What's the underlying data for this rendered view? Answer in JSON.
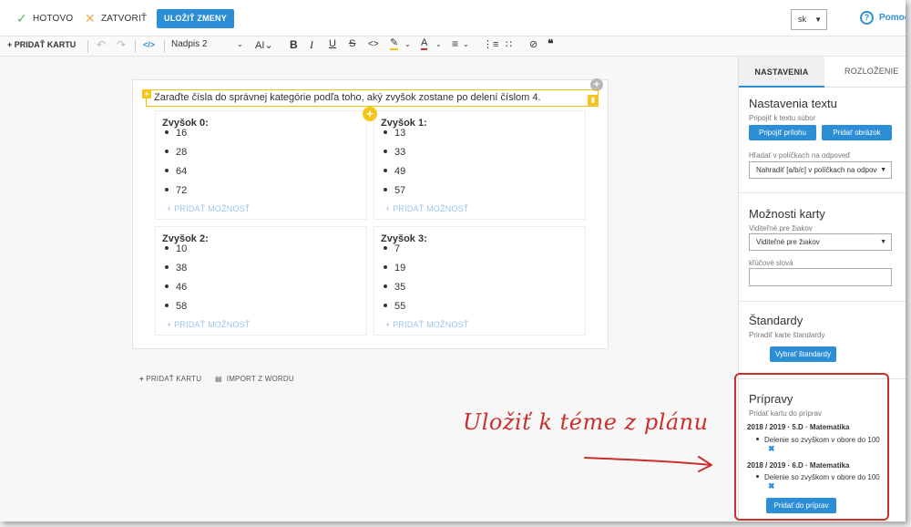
{
  "topbar": {
    "done_label": "HOTOVO",
    "close_label": "ZATVORIŤ",
    "save_label": "ULOŽIŤ ZMENY",
    "language": "sk",
    "help_label": "Pomoc",
    "done_icon": "checkmark-icon",
    "close_icon": "x-icon"
  },
  "toolbar": {
    "add_card_label": "PRIDAŤ KARTU",
    "heading_style": "Nadpis 2",
    "font_size_label": "AI"
  },
  "question": {
    "text": "Zaraďte čísla do správnej kategórie podľa toho, aký zvyšok zostane po delení číslom 4."
  },
  "buckets": [
    {
      "title": "Zvyšok 0:",
      "items": [
        "16",
        "28",
        "64",
        "72"
      ],
      "add_label": "PRIDAŤ MOŽNOSŤ"
    },
    {
      "title": "Zvyšok 1:",
      "items": [
        "13",
        "33",
        "49",
        "57"
      ],
      "add_label": "PRIDAŤ MOŽNOSŤ"
    },
    {
      "title": "Zvyšok 2:",
      "items": [
        "10",
        "38",
        "46",
        "58"
      ],
      "add_label": "PRIDAŤ MOŽNOSŤ"
    },
    {
      "title": "Zvyšok 3:",
      "items": [
        "7",
        "19",
        "35",
        "55"
      ],
      "add_label": "PRIDAŤ MOŽNOSŤ"
    }
  ],
  "below_card": {
    "add_card_label": "PRIDAŤ KARTU",
    "import_label": "IMPORT Z WORDU"
  },
  "panel": {
    "tabs": [
      "NASTAVENIA",
      "ROZLOŽENIE"
    ],
    "text_settings": {
      "title": "Nastavenia textu",
      "attach_label": "Pripojiť k textu súbor",
      "attach_btn": "Pripojiť prílohu",
      "image_btn": "Pridať obrázok",
      "search_label": "Hľadať v políčkach na odpoveď",
      "search_value": "Nahradiť [a/b/c] v políčkach na odpoveď"
    },
    "card_options": {
      "title": "Možnosti karty",
      "visible_label": "Viditeľné pre žiakov",
      "visible_value": "Viditeľné pre žiakov",
      "keywords_label": "kľúčové slová"
    },
    "standards": {
      "title": "Štandardy",
      "assign_label": "Priradiť karte štandardy",
      "select_btn": "Vybrať štandardy"
    },
    "preparations": {
      "title": "Prípravy",
      "add_label": "Pridať kartu do príprav",
      "plans": [
        {
          "title": "2018 / 2019 · 5.D · Matematika",
          "item": "Delenie so zvyškom v obore do 100"
        },
        {
          "title": "2018 / 2019 · 6.D · Matematika",
          "item": "Delenie so zvyškom v obore do 100"
        }
      ],
      "add_btn": "Pridať do príprav"
    }
  },
  "annotation": {
    "text": "Uložiť k téme z plánu",
    "color": "#c9302c"
  },
  "colors": {
    "accent": "#2d8ed8",
    "highlight": "#f5c518",
    "annotation": "#c9302c"
  }
}
